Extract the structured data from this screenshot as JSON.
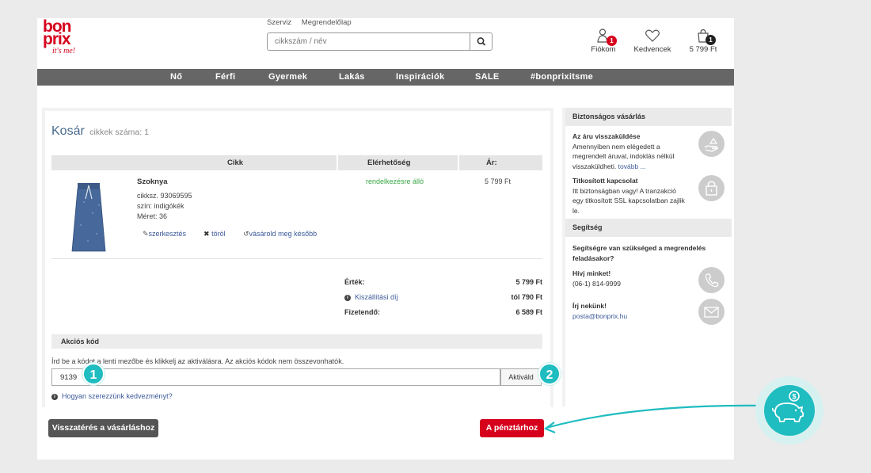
{
  "header": {
    "logo": {
      "line1": "bon",
      "line2": "prix",
      "tagline": "it's me!"
    },
    "top_links": [
      "Szerviz",
      "Megrendelőlap"
    ],
    "search_placeholder": "cikkszám / név",
    "account": {
      "label": "Fiókom",
      "badge": "1"
    },
    "favorites": {
      "label": "Kedvencek"
    },
    "cart": {
      "label": "5 799 Ft",
      "badge": "1"
    }
  },
  "nav": [
    "Nő",
    "Férfi",
    "Gyermek",
    "Lakás",
    "Inspirációk",
    "SALE",
    "#bonprixitsme"
  ],
  "cart": {
    "title": "Kosár",
    "count_label": "cikkek száma: 1",
    "columns": {
      "item": "Cikk",
      "availability": "Elérhetőség",
      "price": "Ár:"
    },
    "product": {
      "name": "Szoknya",
      "sku": "cikksz. 93069595",
      "color": "szín: indigókék",
      "size": "Méret: 36",
      "availability": "rendelkezésre álló",
      "price": "5 799 Ft",
      "actions": {
        "edit": "szerkesztés",
        "delete": "töröl",
        "later": "vásárold meg később"
      }
    },
    "summary": {
      "value_label": "Érték:",
      "value": "5 799 Ft",
      "shipping_label": "Kiszállítási díj",
      "shipping": "tól 790 Ft",
      "total_label": "Fizetendő:",
      "total": "6 589 Ft"
    },
    "promo": {
      "heading": "Akciós kód",
      "instructions": "Írd be a kódot a lenti mezőbe és klikkelj az aktiválásra. Az akciós kódok nem összevonhatók.",
      "code_value": "9139",
      "activate_label": "Aktiváld",
      "help_link": "Hogyan szerezzünk kedvezményt?"
    },
    "back_button": "Visszatérés a vásárláshoz",
    "checkout_button": "A pénztárhoz"
  },
  "sidebar": {
    "secure_heading": "Biztonságos vásárlás",
    "return_title": "Az áru visszaküldése",
    "return_line1": "Amennyiben nem elégedett a",
    "return_line2": "megrendelt áruval, indoklás nélkül",
    "return_line3": "visszaküldheti.",
    "return_more": "tovább ...",
    "ssl_title": "Titkosított kapcsolat",
    "ssl_line1": "Itt biztonságban vagy! A tranzakció",
    "ssl_line2": "egy titkosított SSL kapcsolatban zajlik",
    "ssl_line3": "le.",
    "help_heading": "Segítség",
    "help_question_1": "Segítségre van szükséged a megrendelés",
    "help_question_2": "feladásakor?",
    "call_title": "Hívj minket!",
    "call_number": "(06-1) 814-9999",
    "mail_title": "Írj nekünk!",
    "mail_address": "posta@bonprix.hu"
  },
  "annotations": {
    "marker1": "1",
    "marker2": "2"
  },
  "colors": {
    "brand": "#d6001c",
    "accent": "#1fbcc0",
    "nav_bg": "#666666",
    "link": "#3b5998",
    "available": "#39a846"
  }
}
